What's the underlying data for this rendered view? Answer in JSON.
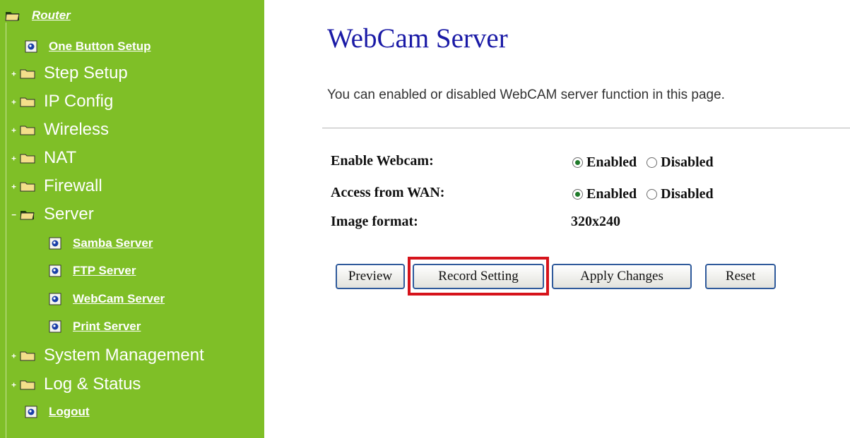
{
  "sidebar": {
    "root_label": "Router",
    "one_button_setup": "One Button Setup",
    "step_setup": "Step Setup",
    "ip_config": "IP Config",
    "wireless": "Wireless",
    "nat": "NAT",
    "firewall": "Firewall",
    "server": "Server",
    "samba_server": "Samba Server",
    "ftp_server": "FTP Server",
    "webcam_server": "WebCam Server",
    "print_server": "Print Server",
    "system_management": "System Management",
    "log_status": "Log & Status",
    "logout": "Logout",
    "plus_glyph": "+",
    "minus_glyph": "−"
  },
  "page": {
    "title": "WebCam Server",
    "description": "You can enabled or disabled WebCAM server function in this page."
  },
  "form": {
    "enable_webcam_label": "Enable Webcam:",
    "access_wan_label": "Access from WAN:",
    "image_format_label": "Image format:",
    "image_format_value": "320x240",
    "enabled_label": "Enabled",
    "disabled_label": "Disabled",
    "enable_webcam_selected": "Enabled",
    "access_wan_selected": "Enabled"
  },
  "buttons": {
    "preview": "Preview",
    "record_setting": "Record Setting",
    "apply_changes": "Apply Changes",
    "reset": "Reset"
  },
  "colors": {
    "sidebar_bg": "#7fbf27",
    "title": "#1a1aa6",
    "highlight": "#d6131b",
    "radio_selected": "#1f7a2a"
  },
  "icons": {
    "folder": "folder-icon",
    "open_folder": "folder-open-icon",
    "page": "page-icon"
  }
}
